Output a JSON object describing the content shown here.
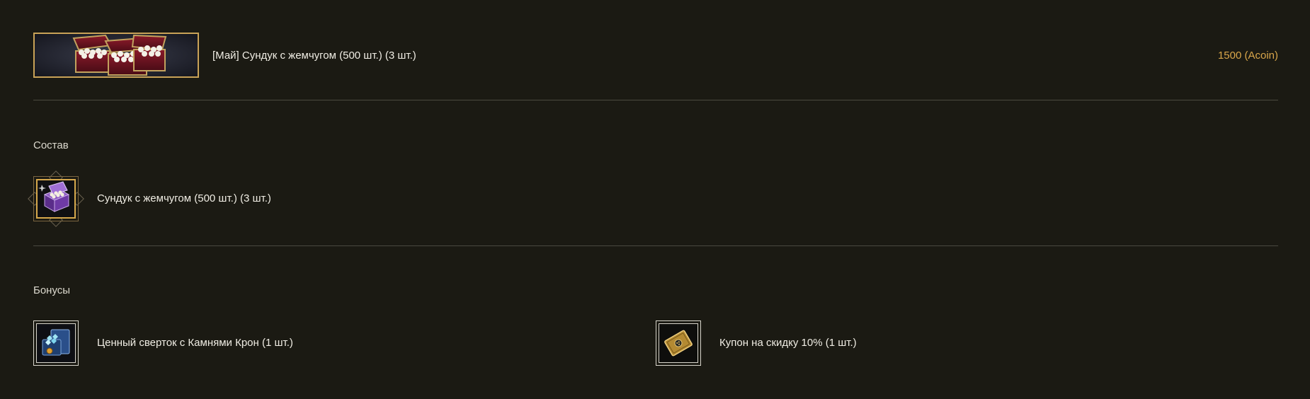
{
  "product": {
    "title": "[Май] Сундук с жемчугом (500 шт.) (3 шт.)",
    "price": "1500 (Acoin)",
    "banner_icon": "pearl-chests-banner"
  },
  "composition": {
    "heading": "Состав",
    "items": [
      {
        "name": "Сундук с жемчугом (500 шт.) (3 шт.)",
        "icon": "purple-pearl-chest-icon"
      }
    ]
  },
  "bonuses": {
    "heading": "Бонусы",
    "items": [
      {
        "name": "Ценный сверток с Камнями Крон (1 шт.)",
        "icon": "crown-gems-bundle-icon"
      },
      {
        "name": "Купон на скидку 10% (1 шт.)",
        "icon": "discount-coupon-icon"
      }
    ]
  },
  "colors": {
    "background": "#1b1a13",
    "accent_gold": "#d9a64a",
    "divider": "#4b4a40"
  }
}
